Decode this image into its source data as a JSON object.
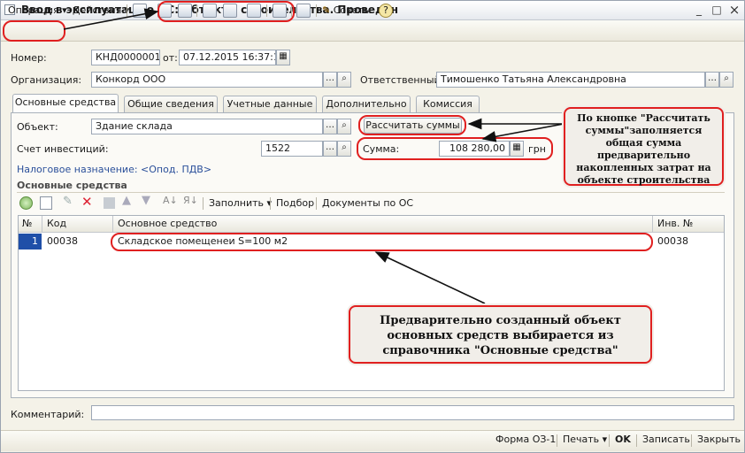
{
  "window": {
    "title_prefix": "Ввод в эксплуатацию ОС:",
    "title_kind": "Объекты строительства.",
    "title_status": "Проведен",
    "minimize": "_",
    "maximize": "□",
    "close": "×"
  },
  "toolbar": {
    "operation": "Операция",
    "actions": "Действия",
    "tips": "Советы",
    "help": "?"
  },
  "header": {
    "number_label": "Номер:",
    "number_value": "КНД00000011",
    "date_label": "от:",
    "date_value": "07.12.2015 16:37:12",
    "org_label": "Организация:",
    "org_value": "Конкорд ООО",
    "responsible_label": "Ответственный:",
    "responsible_value": "Тимошенко Татьяна Александровна"
  },
  "tabs": [
    {
      "label": "Основные средства"
    },
    {
      "label": "Общие сведения"
    },
    {
      "label": "Учетные данные"
    },
    {
      "label": "Дополнительно"
    },
    {
      "label": "Комиссия"
    }
  ],
  "main": {
    "object_label": "Объект:",
    "object_value": "Здание склада",
    "investment_label": "Счет инвестиций:",
    "investment_value": "1522",
    "calc_button": "Рассчитать суммы",
    "sum_label": "Сумма:",
    "sum_value": "108 280,00",
    "sum_currency": "грн",
    "tax_link": "Налоговое назначение: <Опод. ПДВ>",
    "section_title": "Основные средства"
  },
  "grid_toolbar": {
    "fill": "Заполнить",
    "select": "Подбор",
    "docs": "Документы по ОС"
  },
  "grid": {
    "columns": [
      "№",
      "Код",
      "Основное средство",
      "Инв. №"
    ],
    "rows": [
      {
        "n": "1",
        "code": "00038",
        "asset": "Складское помещенеи S=100 м2",
        "inv": "00038"
      }
    ]
  },
  "callouts": {
    "top": "По кнопке \"Рассчитать суммы\"заполняется общая сумма предварительно накопленных затрат на объекте строительства",
    "bottom": "Предварительно созданный объект основных средств выбирается из справочника \"Основные средства\""
  },
  "comment_label": "Комментарий:",
  "footer": {
    "form": "Форма ОЗ-1",
    "print": "Печать",
    "ok": "OK",
    "save": "Записать",
    "close": "Закрыть"
  }
}
